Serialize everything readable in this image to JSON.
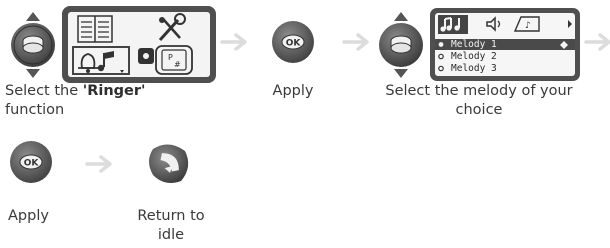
{
  "step1": {
    "caption_prefix": "Select the ",
    "caption_bold": "'Ringer'",
    "caption_suffix": "function"
  },
  "step2": {
    "caption": "Apply",
    "ok_label": "OK"
  },
  "step3": {
    "caption": "Select the melody of your choice",
    "menu_items": [
      "Melody 1",
      "Melody 2",
      "Melody 3"
    ]
  },
  "step4": {
    "caption": "Apply",
    "ok_label": "OK"
  },
  "step5": {
    "caption": "Return to idle"
  },
  "colors": {
    "arrow": "#dcdcdc",
    "button_dark": "#5a5a5a",
    "screen_frame": "#4f4f4f"
  },
  "icons": [
    "navigation-key-icon",
    "ok-key-icon",
    "hang-up-key-icon",
    "right-arrow-icon",
    "music-notes-icon",
    "speaker-icon",
    "settings-tools-icon"
  ]
}
